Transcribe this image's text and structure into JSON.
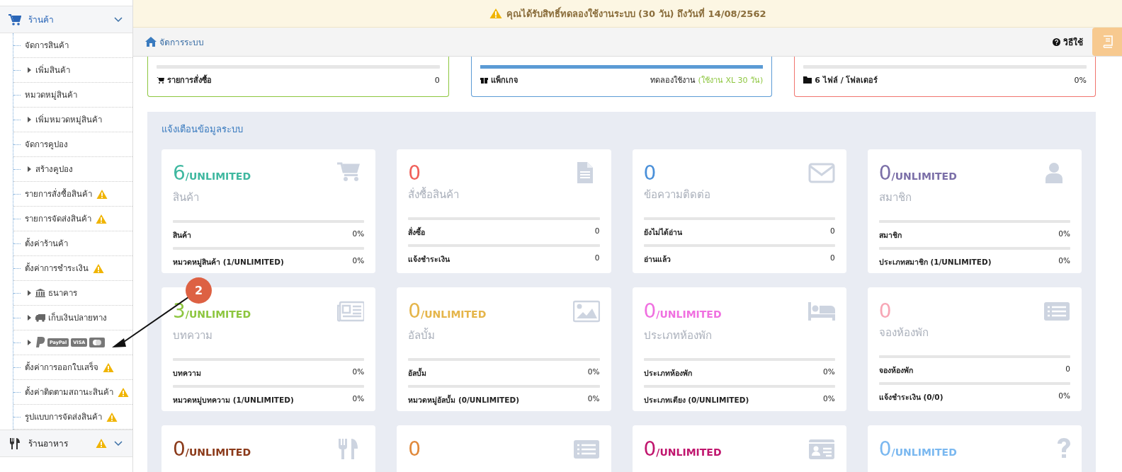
{
  "notice": {
    "text": "คุณได้รับสิทธิ์ทดลองใช้งานระบบ (30 วัน) ถึงวันที่ 14/08/2562"
  },
  "breadcrumb": {
    "label": "จัดการระบบ"
  },
  "help": {
    "label": "วิธีใช้"
  },
  "sidebar": {
    "sections": [
      {
        "label": "ร้านค้า",
        "warn": false,
        "children": [
          {
            "label": "จัดการสินค้า",
            "warn": false,
            "children": [
              {
                "label": "เพิ่มสินค้า"
              }
            ]
          },
          {
            "label": "หมวดหมู่สินค้า",
            "warn": false,
            "children": [
              {
                "label": "เพิ่มหมวดหมู่สินค้า"
              }
            ]
          },
          {
            "label": "จัดการคูปอง",
            "warn": false,
            "children": [
              {
                "label": "สร้างคูปอง"
              }
            ]
          },
          {
            "label": "รายการสั่งซื้อสินค้า",
            "warn": true
          },
          {
            "label": "รายการจัดส่งสินค้า",
            "warn": true
          },
          {
            "label": "ตั้งค่าร้านค้า",
            "warn": false
          },
          {
            "label": "ตั้งค่าการชำระเงิน",
            "warn": true,
            "children": [
              {
                "kind": "bank",
                "label": "ธนาคาร"
              },
              {
                "kind": "truck",
                "label": "เก็บเงินปลายทาง"
              },
              {
                "kind": "logos",
                "logos": [
                  "PayPal",
                  "VISA"
                ]
              }
            ]
          },
          {
            "label": "ตั้งค่าการออกใบเสร็จ",
            "warn": true
          },
          {
            "label": "ตั้งค่าติดตามสถานะสินค้า",
            "warn": true
          },
          {
            "label": "รูปแบบการจัดส่งสินค้า",
            "warn": true
          }
        ]
      },
      {
        "label": "ร้านอาหาร",
        "warn": true
      }
    ]
  },
  "summary_cards": [
    {
      "color": "#8dc63f",
      "level": 0,
      "label": "รายการสั่งซื้อ",
      "value": "0"
    },
    {
      "color": "#5b9bd5",
      "level": 1,
      "label": "แพ็กเกจ",
      "value": "ทดลองใช้งาน",
      "note": "(ใช้งาน XL 30 วัน)"
    },
    {
      "color": "#f0746e",
      "level": 0,
      "label": "6 ไฟล์ / โฟลเดอร์",
      "value": "0%"
    }
  ],
  "panel": {
    "title": "แจ้งเตือนข้อมูลระบบ"
  },
  "stat_cards": [
    {
      "count": "6",
      "limit": "/UNLIMITED",
      "color": "#3fb8a0",
      "title": "สินค้า",
      "rows": [
        {
          "label": "สินค้า",
          "value": "0%",
          "level": 0
        },
        {
          "label": "หมวดหมู่สินค้า (1/UNLIMITED)",
          "value": "0%",
          "level": 0
        }
      ]
    },
    {
      "count": "0",
      "color": "#f0605a",
      "title": "สั่งซื้อสินค้า",
      "rows": [
        {
          "label": "สั่งซื้อ",
          "value": "0",
          "level": 0
        },
        {
          "label": "แจ้งชำระเงิน",
          "value": "0",
          "level": 0
        }
      ]
    },
    {
      "count": "0",
      "color": "#4a90d9",
      "title": "ข้อความติดต่อ",
      "rows": [
        {
          "label": "ยังไม่ได้อ่าน",
          "value": "0",
          "level": 0
        },
        {
          "label": "อ่านแล้ว",
          "value": "0",
          "level": 0
        }
      ]
    },
    {
      "count": "0",
      "limit": "/UNLIMITED",
      "color": "#7b6fa8",
      "title": "สมาชิก",
      "rows": [
        {
          "label": "สมาชิก",
          "value": "0%",
          "level": 0
        },
        {
          "label": "ประเภทสมาชิก (1/UNLIMITED)",
          "value": "0%",
          "level": 0
        }
      ]
    },
    {
      "count": "3",
      "limit": "/UNLIMITED",
      "color": "#8dc63f",
      "title": "บทความ",
      "rows": [
        {
          "label": "บทความ",
          "value": "0%",
          "level": 0
        },
        {
          "label": "หมวดหมู่บทความ (1/UNLIMITED)",
          "value": "0%",
          "level": 0
        }
      ]
    },
    {
      "count": "0",
      "limit": "/UNLIMITED",
      "color": "#e5b54a",
      "title": "อัลบั้ม",
      "rows": [
        {
          "label": "อัลบั้ม",
          "value": "0%",
          "level": 0
        },
        {
          "label": "หมวดหมู่อัลบั้ม (0/UNLIMITED)",
          "value": "0%",
          "level": 0
        }
      ]
    },
    {
      "count": "0",
      "limit": "/UNLIMITED",
      "color": "#f070e0",
      "title": "ประเภทห้องพัก",
      "rows": [
        {
          "label": "ประเภทห้องพัก",
          "value": "0%",
          "level": 0
        },
        {
          "label": "ประเภทเตียง (0/UNLIMITED)",
          "value": "0%",
          "level": 0
        }
      ]
    },
    {
      "count": "0",
      "color": "#f7a6b5",
      "title": "จองห้องพัก",
      "rows": [
        {
          "label": "จองห้องพัก",
          "value": "0",
          "level": 0
        },
        {
          "label": "แจ้งชำระเงิน (0/0)",
          "value": "0%",
          "level": 0
        }
      ]
    },
    {
      "count": "0",
      "limit": "/UNLIMITED",
      "color": "#8b3a1a"
    },
    {
      "count": "0",
      "color": "#e0883a"
    },
    {
      "count": "0",
      "limit": "/UNLIMITED",
      "color": "#c0166e"
    },
    {
      "count": "0",
      "limit": "/UNLIMITED",
      "color": "#7ab8f0"
    }
  ],
  "annotation": {
    "badge": "2"
  }
}
